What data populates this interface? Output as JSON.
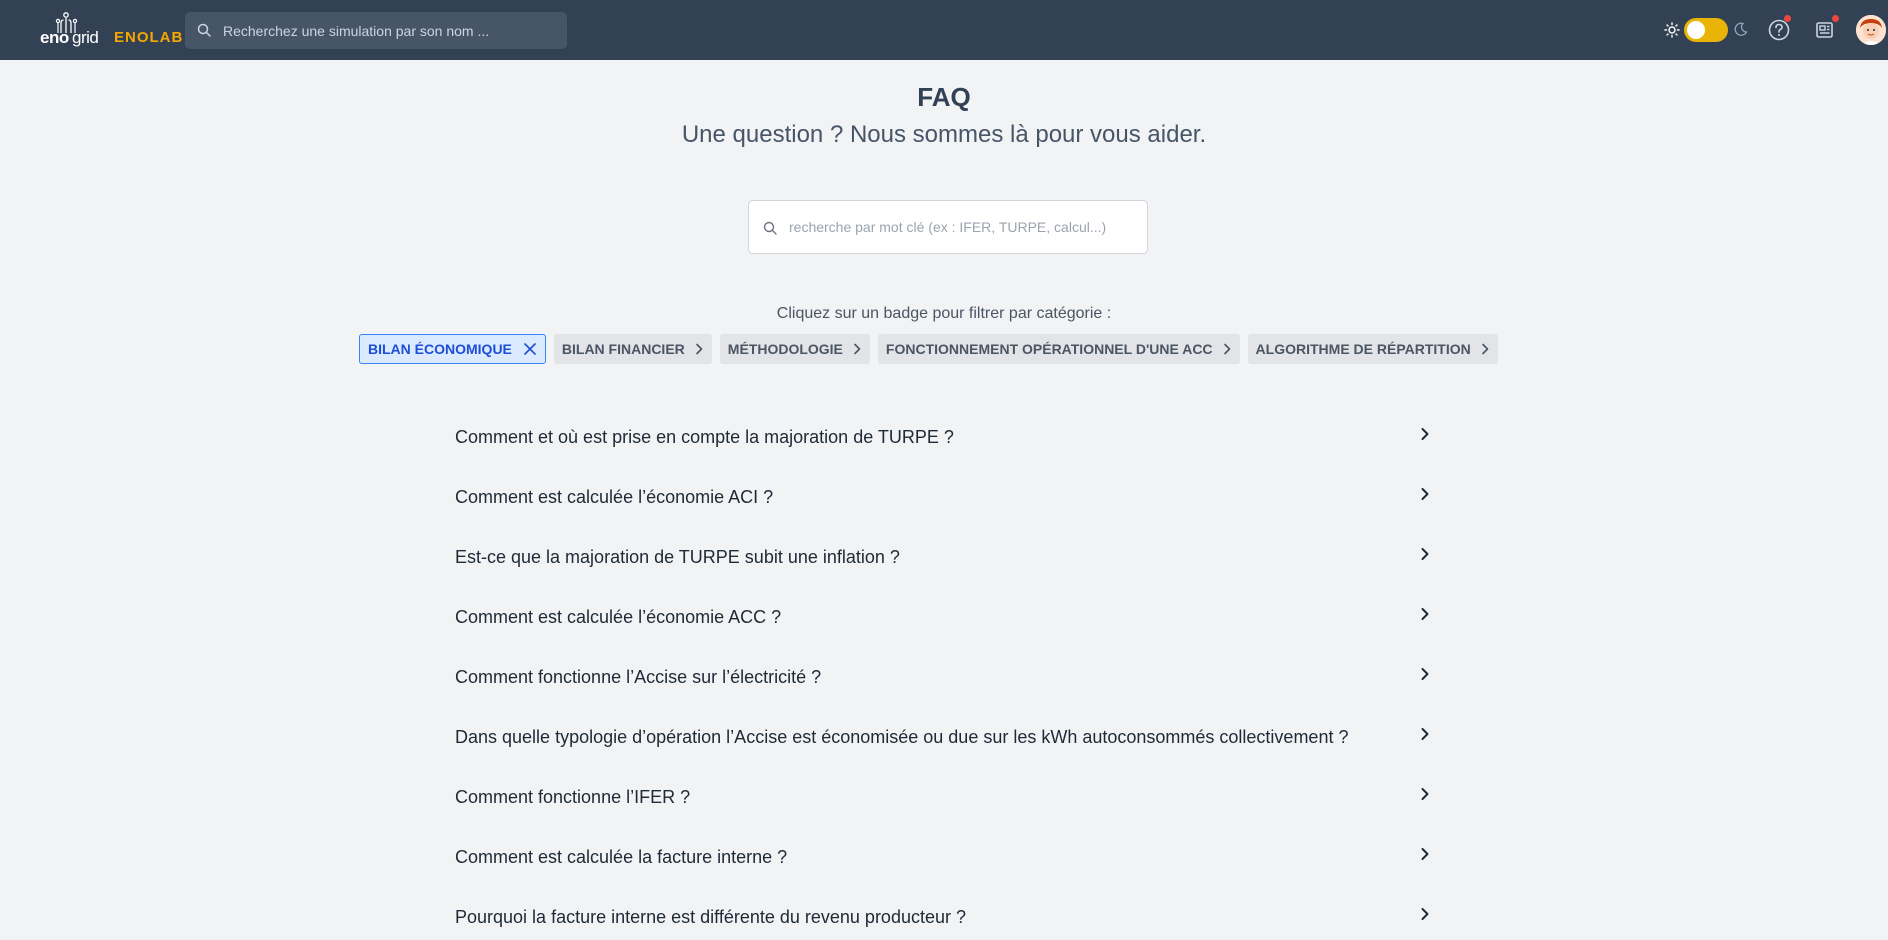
{
  "header": {
    "logo_eno": "eno",
    "logo_grid": "grid",
    "logo_enolab": "ENOLAB",
    "search_placeholder": "Recherchez une simulation par son nom ...",
    "icons": [
      "search-icon",
      "sun-icon",
      "theme-toggle",
      "moon-icon",
      "help-icon",
      "news-icon",
      "avatar"
    ],
    "accent_color": "#f5a900",
    "toggle_color": "#eab308",
    "notification_color": "#ef4444"
  },
  "page": {
    "title": "FAQ",
    "subtitle": "Une question ? Nous sommes là pour vous aider.",
    "search_placeholder": "recherche par mot clé (ex : IFER, TURPE, calcul...)",
    "filter_hint": "Cliquez sur un badge pour filtrer par catégorie :"
  },
  "badges": [
    {
      "label": "BILAN ÉCONOMIQUE",
      "active": true,
      "icon": "close-icon"
    },
    {
      "label": "BILAN FINANCIER",
      "active": false,
      "icon": "chevron-right-icon"
    },
    {
      "label": "MÉTHODOLOGIE",
      "active": false,
      "icon": "chevron-right-icon"
    },
    {
      "label": "FONCTIONNEMENT OPÉRATIONNEL D'UNE ACC",
      "active": false,
      "icon": "chevron-right-icon"
    },
    {
      "label": "ALGORITHME DE RÉPARTITION",
      "active": false,
      "icon": "chevron-right-icon"
    }
  ],
  "questions": [
    "Comment et où est prise en compte la majoration de TURPE ?",
    "Comment est calculée l’économie ACI ?",
    "Est-ce que la majoration de TURPE subit une inflation ?",
    "Comment est calculée l’économie ACC ?",
    "Comment fonctionne l’Accise sur l’électricité ?",
    "Dans quelle typologie d’opération l’Accise est économisée ou due sur les kWh autoconsommés collectivement ?",
    "Comment fonctionne l’IFER ?",
    "Comment est calculée la facture interne ?",
    "Pourquoi la facture interne est différente du revenu producteur ?"
  ]
}
